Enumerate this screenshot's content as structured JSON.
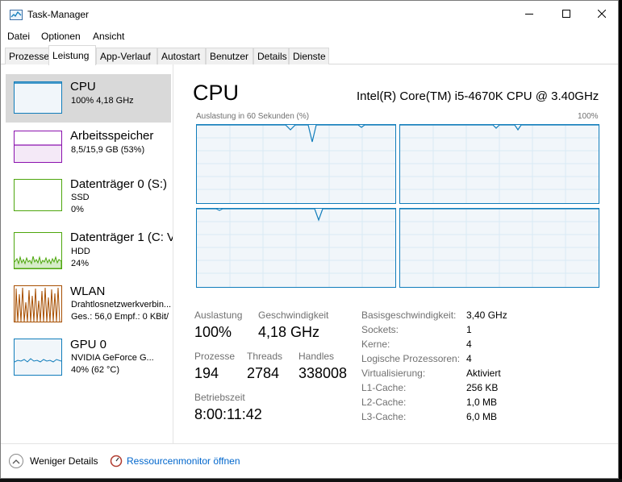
{
  "window": {
    "title": "Task-Manager"
  },
  "menu": [
    "Datei",
    "Optionen",
    "Ansicht"
  ],
  "tabs": [
    "Prozesse",
    "Leistung",
    "App-Verlauf",
    "Autostart",
    "Benutzer",
    "Details",
    "Dienste"
  ],
  "active_tab": "Leistung",
  "resources": [
    {
      "title": "CPU",
      "line1": "100%  4,18 GHz",
      "line2": "",
      "color": "#117dbb",
      "selected": true
    },
    {
      "title": "Arbeitsspeicher",
      "line1": "8,5/15,9 GB (53%)",
      "line2": "",
      "color": "#8b12ae",
      "level": 0.53
    },
    {
      "title": "Datenträger 0 (S:)",
      "line1": "SSD",
      "line2": "0%",
      "color": "#4da60c"
    },
    {
      "title": "Datenträger 1 (C: V",
      "line1": "HDD",
      "line2": "24%",
      "color": "#4da60c"
    },
    {
      "title": "WLAN",
      "line1": "Drahtlosnetzwerkverbin...",
      "line2": "Ges.: 56,0  Empf.: 0 KBit/",
      "color": "#a74f01"
    },
    {
      "title": "GPU 0",
      "line1": "NVIDIA GeForce G...",
      "line2": "40% (62 °C)",
      "color": "#117dbb"
    }
  ],
  "cpu": {
    "title": "CPU",
    "model": "Intel(R) Core(TM) i5-4670K CPU @ 3.40GHz",
    "graph_label": "Auslastung in 60 Sekunden (%)",
    "graph_max": "100%",
    "stats": {
      "auslastung_label": "Auslastung",
      "auslastung": "100%",
      "geschwindigkeit_label": "Geschwindigkeit",
      "geschwindigkeit": "4,18 GHz",
      "prozesse_label": "Prozesse",
      "prozesse": "194",
      "threads_label": "Threads",
      "threads": "2784",
      "handles_label": "Handles",
      "handles": "338008",
      "betriebszeit_label": "Betriebszeit",
      "betriebszeit": "8:00:11:42"
    },
    "info": [
      {
        "label": "Basisgeschwindigkeit:",
        "value": "3,40 GHz"
      },
      {
        "label": "Sockets:",
        "value": "1"
      },
      {
        "label": "Kerne:",
        "value": "4"
      },
      {
        "label": "Logische Prozessoren:",
        "value": "4"
      },
      {
        "label": "Virtualisierung:",
        "value": "Aktiviert"
      },
      {
        "label": "L1-Cache:",
        "value": "256 KB"
      },
      {
        "label": "L2-Cache:",
        "value": "1,0 MB"
      },
      {
        "label": "L3-Cache:",
        "value": "6,0 MB"
      }
    ]
  },
  "footer": {
    "less_details": "Weniger Details",
    "resource_monitor": "Ressourcenmonitor öffnen"
  },
  "colors": {
    "cpu_line": "#117dbb",
    "graph_bg": "#f1f6fa",
    "grid": "#d9eaf4",
    "link": "#0066cc"
  }
}
